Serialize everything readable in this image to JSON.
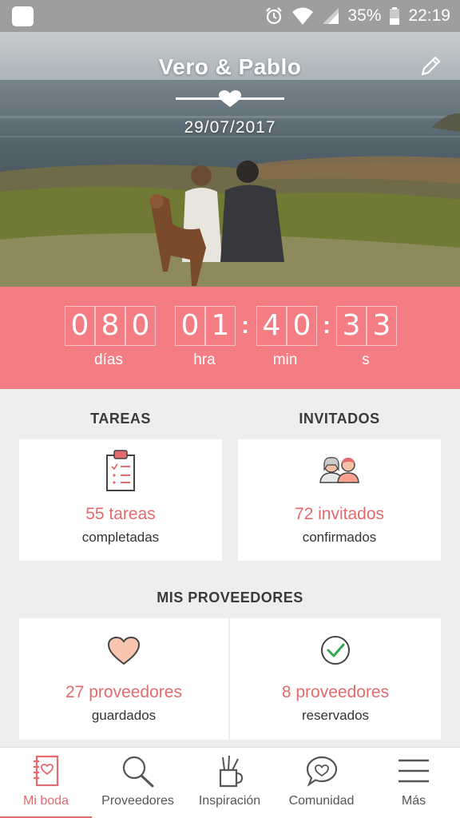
{
  "status_bar": {
    "battery_percent": "35%",
    "time": "22:19",
    "icons": [
      "app-icon",
      "alarm-icon",
      "wifi-icon",
      "signal-icon",
      "battery-icon"
    ]
  },
  "hero": {
    "couple_names": "Vero & Pablo",
    "wedding_date": "29/07/2017",
    "icons": [
      "heart-divider-icon",
      "edit-pencil-icon"
    ]
  },
  "countdown": {
    "days": [
      "0",
      "8",
      "0"
    ],
    "hours": [
      "0",
      "1"
    ],
    "minutes": [
      "4",
      "0"
    ],
    "seconds": [
      "3",
      "3"
    ],
    "separator": ":",
    "labels": {
      "days": "días",
      "hours": "hra",
      "minutes": "min",
      "seconds": "s"
    }
  },
  "tasks": {
    "heading": "TAREAS",
    "count_text": "55 tareas",
    "subtitle": "completadas",
    "icon": "clipboard-checklist-icon"
  },
  "guests": {
    "heading": "INVITADOS",
    "count_text": "72 invitados",
    "subtitle": "confirmados",
    "icon": "guests-couple-icon"
  },
  "vendors": {
    "heading": "MIS PROVEEDORES",
    "saved": {
      "count_text": "27 proveedores",
      "subtitle": "guardados",
      "icon": "heart-icon"
    },
    "booked": {
      "count_text": "8 proveedores",
      "subtitle": "reservados",
      "icon": "check-circle-icon"
    }
  },
  "bottom_nav": {
    "items": [
      {
        "label": "Mi boda",
        "icon": "notebook-icon",
        "active": true
      },
      {
        "label": "Proveedores",
        "icon": "search-icon",
        "active": false
      },
      {
        "label": "Inspiración",
        "icon": "pencil-cup-icon",
        "active": false
      },
      {
        "label": "Comunidad",
        "icon": "chat-heart-icon",
        "active": false
      },
      {
        "label": "Más",
        "icon": "menu-icon",
        "active": false
      }
    ]
  },
  "colors": {
    "accent": "#f47d83",
    "accent_text": "#e36a6d",
    "status_bar": "#9e9e9e",
    "background": "#eeeeee"
  }
}
